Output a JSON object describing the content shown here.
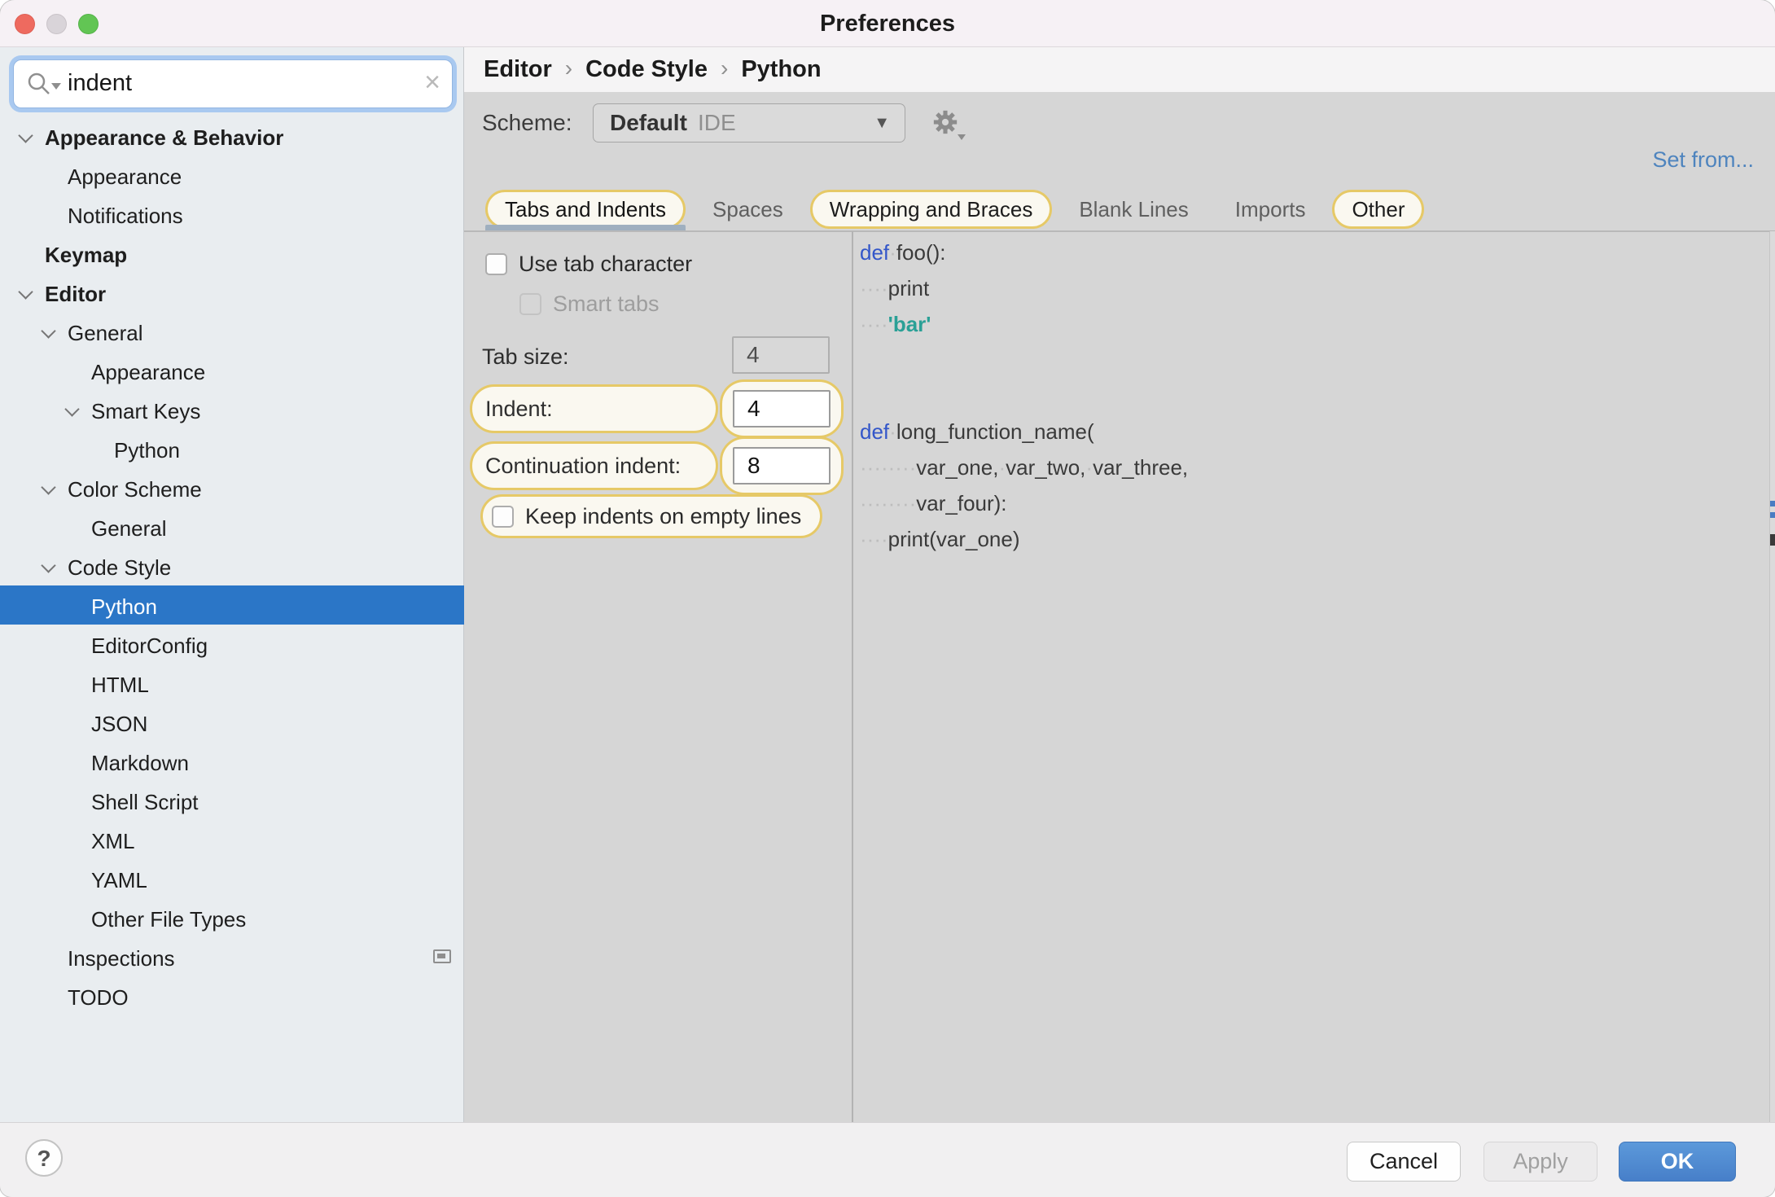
{
  "window": {
    "title": "Preferences"
  },
  "search": {
    "value": "indent"
  },
  "sidebar": {
    "tree": [
      {
        "label": "Appearance & Behavior",
        "level": 1,
        "bold": true,
        "chevron": true
      },
      {
        "label": "Appearance",
        "level": 2
      },
      {
        "label": "Notifications",
        "level": 2
      },
      {
        "label": "Keymap",
        "level": 1,
        "bold": true
      },
      {
        "label": "Editor",
        "level": 1,
        "bold": true,
        "chevron": true
      },
      {
        "label": "General",
        "level": 2,
        "chevron": true
      },
      {
        "label": "Appearance",
        "level": 3
      },
      {
        "label": "Smart Keys",
        "level": 3,
        "chevron": true
      },
      {
        "label": "Python",
        "level": 4
      },
      {
        "label": "Color Scheme",
        "level": 2,
        "chevron": true
      },
      {
        "label": "General",
        "level": 3
      },
      {
        "label": "Code Style",
        "level": 2,
        "chevron": true
      },
      {
        "label": "Python",
        "level": 3,
        "selected": true
      },
      {
        "label": "EditorConfig",
        "level": 3
      },
      {
        "label": "HTML",
        "level": 3
      },
      {
        "label": "JSON",
        "level": 3
      },
      {
        "label": "Markdown",
        "level": 3
      },
      {
        "label": "Shell Script",
        "level": 3
      },
      {
        "label": "XML",
        "level": 3
      },
      {
        "label": "YAML",
        "level": 3
      },
      {
        "label": "Other File Types",
        "level": 3
      },
      {
        "label": "Inspections",
        "level": 2,
        "icon": "inspections-profile-icon"
      },
      {
        "label": "TODO",
        "level": 2
      }
    ]
  },
  "breadcrumb": {
    "items": [
      "Editor",
      "Code Style",
      "Python"
    ],
    "separator": "›"
  },
  "scheme": {
    "label": "Scheme:",
    "value": "Default",
    "suffix": "IDE",
    "caret": "▼",
    "set_from": "Set from..."
  },
  "tabs": [
    {
      "label": "Tabs and Indents",
      "active": true,
      "highlighted": true
    },
    {
      "label": "Spaces"
    },
    {
      "label": "Wrapping and Braces",
      "highlighted": true
    },
    {
      "label": "Blank Lines"
    },
    {
      "label": "Imports"
    },
    {
      "label": "Other",
      "highlighted": true
    }
  ],
  "form": {
    "use_tab_character": {
      "label": "Use tab character",
      "checked": false
    },
    "smart_tabs": {
      "label": "Smart tabs",
      "checked": false,
      "disabled": true
    },
    "tab_size": {
      "label": "Tab size:",
      "value": "4"
    },
    "indent": {
      "label": "Indent:",
      "value": "4",
      "highlighted": true
    },
    "continuation_indent": {
      "label": "Continuation indent:",
      "value": "8",
      "highlighted": true
    },
    "keep_indents": {
      "label": "Keep indents on empty lines",
      "checked": false,
      "highlighted": true
    }
  },
  "code": {
    "lines": [
      [
        {
          "t": "def",
          "s": "kw"
        },
        {
          "t": "·",
          "s": "ws"
        },
        {
          "t": "foo():",
          "s": "pl"
        }
      ],
      [
        {
          "t": "····",
          "s": "ws"
        },
        {
          "t": "print",
          "s": "pl"
        }
      ],
      [
        {
          "t": "····",
          "s": "ws"
        },
        {
          "t": "'bar'",
          "s": "str"
        }
      ],
      [],
      [],
      [
        {
          "t": "def",
          "s": "kw"
        },
        {
          "t": "·",
          "s": "ws"
        },
        {
          "t": "long_function_name(",
          "s": "pl"
        }
      ],
      [
        {
          "t": "········",
          "s": "ws"
        },
        {
          "t": "var_one,",
          "s": "pl"
        },
        {
          "t": "·",
          "s": "ws"
        },
        {
          "t": "var_two,",
          "s": "pl"
        },
        {
          "t": "·",
          "s": "ws"
        },
        {
          "t": "var_three,",
          "s": "pl"
        }
      ],
      [
        {
          "t": "········",
          "s": "ws"
        },
        {
          "t": "var_four):",
          "s": "pl"
        }
      ],
      [
        {
          "t": "····",
          "s": "ws"
        },
        {
          "t": "print(var_one)",
          "s": "pl"
        }
      ]
    ]
  },
  "footer": {
    "help": "?",
    "cancel": "Cancel",
    "apply": "Apply",
    "ok": "OK"
  },
  "colors": {
    "titlebar": "#F6F1F5",
    "sidebar": "#E9EDF0",
    "panel": "#D6D6D6",
    "selection": "#2B76C7",
    "highlight_border": "#E6C967",
    "highlight_bg": "#FAF8F0",
    "keyword": "#3356C9",
    "string": "#2AA096",
    "whitespace_dot": "#BDBDBD",
    "link": "#4E84BE",
    "ok_button": "#477FC9",
    "traffic_close": "#EE6A5F",
    "traffic_minimize": "#D9D4D9",
    "traffic_zoom": "#62C554"
  }
}
